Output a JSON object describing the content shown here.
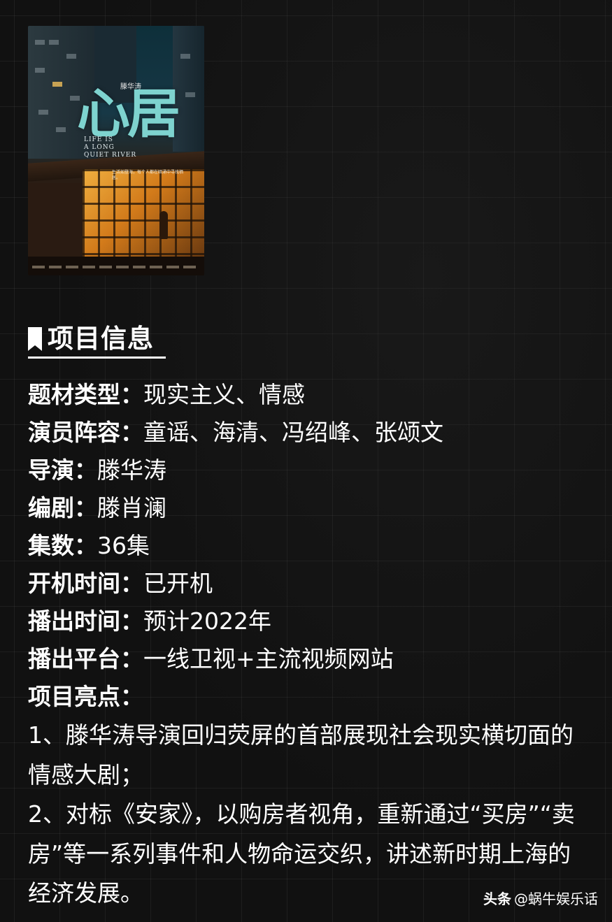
{
  "poster": {
    "title": "心居",
    "director_credit": "滕华涛",
    "english_title": "LIFE IS\nA LONG\nQUIET RIVER",
    "tagline": "生活如登海，每个人都在暗涌中寻找栖居。"
  },
  "heading": {
    "text": "项目信息"
  },
  "info": [
    {
      "label": "题材类型：",
      "value": "现实主义、情感"
    },
    {
      "label": "演员阵容：",
      "value": "童谣、海清、冯绍峰、张颂文"
    },
    {
      "label": "导演：",
      "value": "滕华涛"
    },
    {
      "label": "编剧：",
      "value": "滕肖澜"
    },
    {
      "label": "集数：",
      "value": "36集"
    },
    {
      "label": "开机时间：",
      "value": "已开机"
    },
    {
      "label": "播出时间：",
      "value": "预计2022年"
    },
    {
      "label": "播出平台：",
      "value": "一线卫视+主流视频网站"
    },
    {
      "label": "项目亮点：",
      "value": ""
    }
  ],
  "highlights": [
    "1、滕华涛导演回归荧屏的首部展现社会现实横切面的情感大剧；",
    "2、对标《安家》，以购房者视角，重新通过“买房”“卖房”等一系列事件和人物命运交织，讲述新时期上海的经济发展。"
  ],
  "watermark": {
    "brand": "头条",
    "account": "@蜗牛娱乐话"
  },
  "colors": {
    "background": "#111111",
    "text": "#ffffff",
    "poster_title": "#7ed3cf"
  }
}
